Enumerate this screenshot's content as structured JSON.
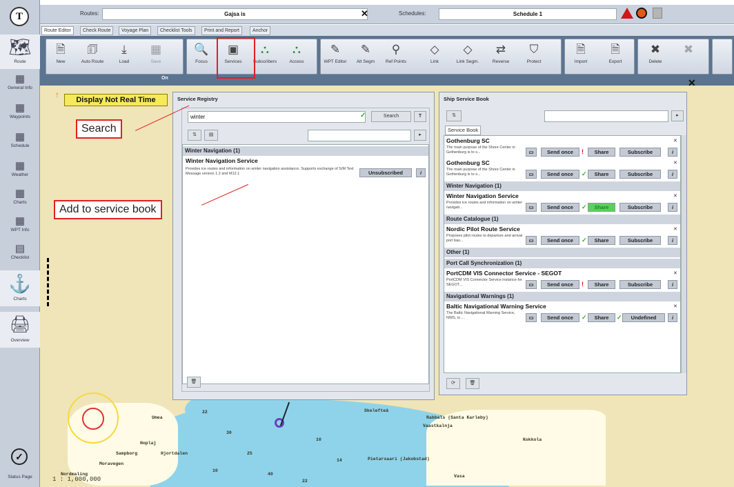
{
  "app": {
    "logo_letter": "T"
  },
  "header": {
    "routes_label": "Routes:",
    "route_value": "Gajsa is",
    "schedules_label": "Schedules:",
    "schedule_value": "Schedule 1"
  },
  "tabs": [
    "Route Editor",
    "Check Route",
    "Voyage Plan",
    "Checklist Tools",
    "Print and Report",
    "Anchor"
  ],
  "toolbar": {
    "tools": [
      {
        "label": "New",
        "icon": "new-route-icon",
        "glyph": "🗎"
      },
      {
        "label": "Auto Route",
        "icon": "auto-route-icon",
        "glyph": "🗊"
      },
      {
        "label": "Load",
        "icon": "load-icon",
        "glyph": "⤓"
      },
      {
        "label": "Save",
        "icon": "save-icon",
        "glyph": "▦"
      },
      {
        "label": "Focus",
        "icon": "focus-icon",
        "glyph": "🔍"
      },
      {
        "label": "Services",
        "icon": "services-icon",
        "glyph": "▣"
      },
      {
        "label": "Subscribers",
        "icon": "subscribers-icon",
        "glyph": "⛬"
      },
      {
        "label": "Access",
        "icon": "access-icon",
        "glyph": "⛬"
      },
      {
        "label": "WPT Editor",
        "icon": "wpt-editor-icon",
        "glyph": "✎"
      },
      {
        "label": "Alt Segm",
        "icon": "alt-segment-icon",
        "glyph": "✎"
      },
      {
        "label": "Ref Points",
        "icon": "ref-points-icon",
        "glyph": "⚲"
      },
      {
        "label": "Link",
        "icon": "link-icon",
        "glyph": "◇"
      },
      {
        "label": "Link Segm.",
        "icon": "link-segment-icon",
        "glyph": "◇"
      },
      {
        "label": "Reverse",
        "icon": "reverse-icon",
        "glyph": "⇄"
      },
      {
        "label": "Protect",
        "icon": "protect-icon",
        "glyph": "⛉"
      },
      {
        "label": "Import",
        "icon": "import-icon",
        "glyph": "🗎"
      },
      {
        "label": "Export",
        "icon": "export-icon",
        "glyph": "🗎"
      },
      {
        "label": "Delete",
        "icon": "delete-icon",
        "glyph": "✖"
      }
    ],
    "on_label": "On"
  },
  "sidebar": {
    "items": [
      {
        "label": "Route",
        "icon": "route-icon"
      },
      {
        "label": "General Info",
        "icon": "general-info-icon"
      },
      {
        "label": "Waypoints",
        "icon": "waypoints-icon"
      },
      {
        "label": "Schedule",
        "icon": "schedule-icon"
      },
      {
        "label": "Weather",
        "icon": "weather-icon"
      },
      {
        "label": "Charts",
        "icon": "charts-icon"
      },
      {
        "label": "WPT Info",
        "icon": "wpt-info-icon"
      },
      {
        "label": "Checklist",
        "icon": "checklist-icon"
      },
      {
        "label": "Charts",
        "icon": "charts-large-icon"
      },
      {
        "label": "Overview",
        "icon": "overview-icon"
      }
    ],
    "status_page": "Status Page"
  },
  "banner": {
    "display_not_real_time": "Display Not Real Time"
  },
  "registry": {
    "title": "Service Registry",
    "search_value": "winter",
    "search_button": "Search",
    "filter_glyph": "T",
    "group": "Winter Navigation (1)",
    "service_name": "Winter Navigation Service",
    "service_desc": "Provides ice routes and information on winter navigation assistance. Supports exchange of S/M Text Message version 1.2 and M12.1",
    "status_button": "Unsubscribed",
    "info_glyph": "i"
  },
  "servicebook": {
    "title": "Ship Service Book",
    "tab": "Service Book",
    "entries": [
      {
        "type": "item",
        "name": "Gothenburg SC",
        "desc": "The main purpose of the Shore Center in Gothenburg is to s...",
        "send": "Send once",
        "mark": "!",
        "share": "Share",
        "share_green": false,
        "share_mark": "",
        "sub": "Subscribe"
      },
      {
        "type": "item",
        "name": "Gothenburg SC",
        "desc": "The main purpose of the Shore Center in Gothenburg is to s...",
        "send": "Send once",
        "mark": "✓",
        "share": "Share",
        "share_green": false,
        "share_mark": "",
        "sub": "Subscribe"
      },
      {
        "type": "group",
        "name": "Winter Navigation (1)"
      },
      {
        "type": "item",
        "name": "Winter Navigation Service",
        "desc": "Provides ice routes and information on winter navigati...",
        "send": "Send once",
        "mark": "✓",
        "share": "Share",
        "share_green": true,
        "share_mark": "",
        "sub": "Subscribe"
      },
      {
        "type": "group",
        "name": "Route Catalogue (1)"
      },
      {
        "type": "item",
        "name": "Nordic Pilot Route Service",
        "desc": "Proposes pilot routes to departure and arrival port bas...",
        "send": "Send once",
        "mark": "✓",
        "share": "Share",
        "share_green": false,
        "share_mark": "",
        "sub": "Subscribe"
      },
      {
        "type": "group",
        "name": "Other (1)"
      },
      {
        "type": "group",
        "name": "Port Call Synchronization (1)"
      },
      {
        "type": "item",
        "name": "PortCDM VIS Connector Service - SEGOT",
        "desc": "PortCDM VIS Connector Service instance for SEGOT...",
        "send": "Send once",
        "mark": "!",
        "share": "Share",
        "share_green": false,
        "share_mark": "",
        "sub": "Subscribe"
      },
      {
        "type": "group",
        "name": "Navigational Warnings (1)"
      },
      {
        "type": "item",
        "name": "Baltic Navigational Warning Service",
        "desc": "The Baltic Navigational Warning Service, NWS, is ...",
        "send": "Send once",
        "mark": "✓",
        "share": "Share",
        "share_green": false,
        "share_mark": "✓",
        "sub": "Undefined"
      }
    ]
  },
  "callouts": {
    "search": "Search",
    "add": "Add to service book"
  },
  "map": {
    "scale": "1 : 1,000,000",
    "place_labels": [
      "Umea",
      "Skelefteå",
      "Nordmaling",
      "Moravegen",
      "Hoplaj",
      "Sampborg",
      "Hjortdalen",
      "Rabbals (Santa Karleby)",
      "Vasa",
      "Pietarsaari (Jakobstad)",
      "Vaastkalnja",
      "Kokkola"
    ],
    "depth_labels": [
      "22",
      "30",
      "25",
      "40",
      "10",
      "14",
      "10",
      "22"
    ]
  },
  "colors": {
    "accent_red": "#e02020",
    "warn_yellow": "#f5ea5a",
    "share_green": "#5ad15a",
    "ribbon": "#5b7490",
    "sea": "#8fd3ea",
    "land": "#efe5b8"
  }
}
